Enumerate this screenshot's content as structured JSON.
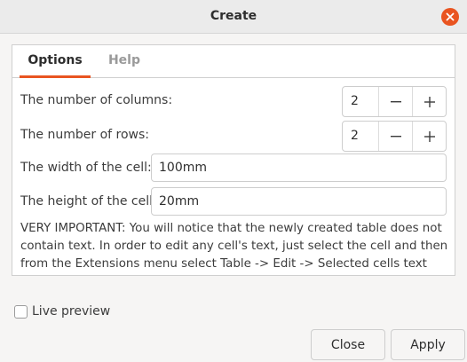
{
  "window": {
    "title": "Create"
  },
  "tabs": [
    {
      "label": "Options",
      "active": true
    },
    {
      "label": "Help",
      "active": false
    }
  ],
  "options": {
    "columns": {
      "label": "The number of columns:",
      "value": "2"
    },
    "rows": {
      "label": "The number of rows:",
      "value": "2"
    },
    "cell_width": {
      "label": "The width of the cell:",
      "value": "100mm"
    },
    "cell_height": {
      "label": "The height of the cell:",
      "value": "20mm"
    },
    "note": "VERY IMPORTANT: You will notice that the newly created table does not contain text. In order to edit any cell's text, just select the cell and then from the Extensions menu select Table -> Edit -> Selected cells text"
  },
  "live_preview": {
    "label": "Live preview",
    "checked": false
  },
  "buttons": {
    "close": "Close",
    "apply": "Apply"
  },
  "colors": {
    "accent": "#e95420"
  }
}
